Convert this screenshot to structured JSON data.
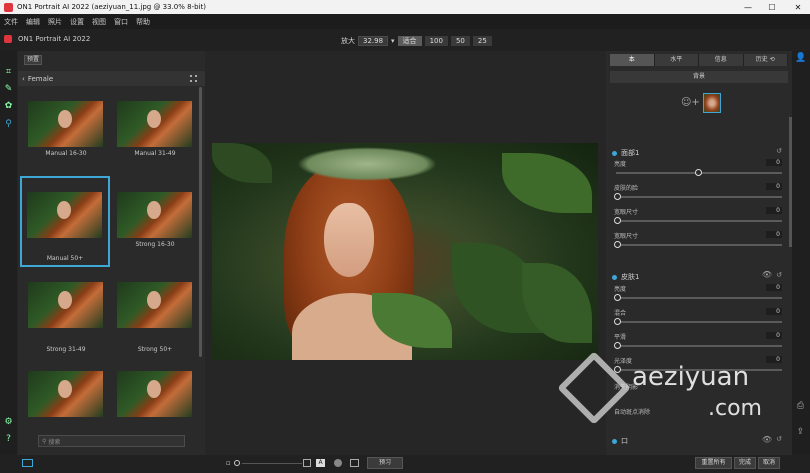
{
  "window": {
    "title": "ON1 Portrait AI 2022 (aeziyuan_11.jpg @ 33.0% 8-bit)",
    "min": "—",
    "max": "☐",
    "close": "✕"
  },
  "menu": [
    "文件",
    "编辑",
    "照片",
    "设置",
    "视图",
    "窗口",
    "帮助"
  ],
  "app": {
    "name": "ON1 Portrait AI 2022"
  },
  "zoom": {
    "label": "放大",
    "value": "32.98",
    "fit": "适合",
    "z100": "100",
    "z50": "50",
    "z25": "25"
  },
  "left": {
    "presets_btn": "预置",
    "folder": "Female",
    "thumbs": [
      "Manual 16-30",
      "Manual 31-49",
      "Manual 50+",
      "Strong 16-30",
      "Strong 31-49",
      "Strong 50+",
      "",
      ""
    ],
    "search_placeholder": "搜索"
  },
  "right": {
    "tabs": [
      "本",
      "水平",
      "信息",
      "历史 ⟲"
    ],
    "background_btn": "背景",
    "face_section": "面部1",
    "face_rows": [
      {
        "label": "亮度",
        "value": "0"
      },
      {
        "label": "皮肤的脸",
        "value": "0"
      },
      {
        "label": "宽眼尺寸",
        "value": "0"
      },
      {
        "label": "宽眼尺寸",
        "value": "0"
      }
    ],
    "skin_section": "皮肤1",
    "skin_rows": [
      {
        "label": "亮度",
        "value": "0"
      },
      {
        "label": "混合",
        "value": "0"
      },
      {
        "label": "平滑",
        "value": "0"
      },
      {
        "label": "光泽度",
        "value": "0"
      }
    ],
    "extra_row1": "消失阴影",
    "extra_row2": "自动斑点消除",
    "bottom_section": "口"
  },
  "bottom": {
    "preview_btn": "预习",
    "reset_all": "重置所有",
    "done": "完成",
    "cancel": "取消"
  },
  "watermark": {
    "brand": "aeziyuan",
    "suffix": ".com"
  }
}
